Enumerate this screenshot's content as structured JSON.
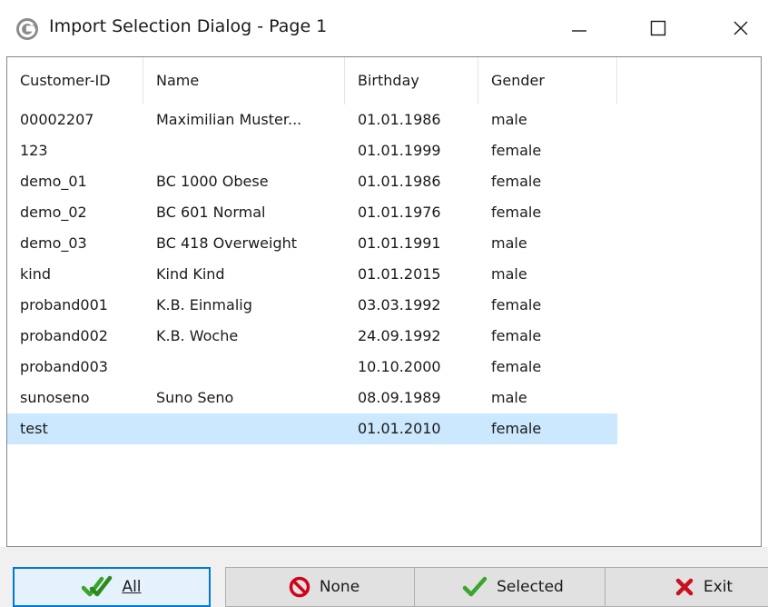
{
  "window": {
    "title": "Import Selection Dialog - Page 1",
    "app_icon_letter": "G"
  },
  "table": {
    "columns": [
      "Customer-ID",
      "Name",
      "Birthday",
      "Gender"
    ],
    "rows": [
      {
        "id": "00002207",
        "name": "Maximilian Muster...",
        "birthday": "01.01.1986",
        "gender": "male"
      },
      {
        "id": "123",
        "name": "",
        "birthday": "01.01.1999",
        "gender": "female"
      },
      {
        "id": "demo_01",
        "name": "BC 1000 Obese",
        "birthday": "01.01.1986",
        "gender": "female"
      },
      {
        "id": "demo_02",
        "name": "BC 601 Normal",
        "birthday": "01.01.1976",
        "gender": "female"
      },
      {
        "id": "demo_03",
        "name": "BC 418 Overweight",
        "birthday": "01.01.1991",
        "gender": "male"
      },
      {
        "id": "kind",
        "name": "Kind Kind",
        "birthday": "01.01.2015",
        "gender": "male"
      },
      {
        "id": "proband001",
        "name": "K.B. Einmalig",
        "birthday": "03.03.1992",
        "gender": "female"
      },
      {
        "id": "proband002",
        "name": "K.B. Woche",
        "birthday": "24.09.1992",
        "gender": "female"
      },
      {
        "id": "proband003",
        "name": "",
        "birthday": "10.10.2000",
        "gender": "female"
      },
      {
        "id": "sunoseno",
        "name": "Suno Seno",
        "birthday": "08.09.1989",
        "gender": "male"
      },
      {
        "id": "test",
        "name": "",
        "birthday": "01.01.2010",
        "gender": "female"
      }
    ],
    "selected_row": 10
  },
  "buttons": {
    "all": "All",
    "none": "None",
    "selected": "Selected",
    "exit": "Exit"
  },
  "icons": {
    "all": "double-checkmark-icon",
    "none": "prohibited-icon",
    "selected": "checkmark-icon",
    "exit": "red-x-icon"
  },
  "colors": {
    "selection": "#cce8ff",
    "check_green": "#3aa52a",
    "none_red": "#d0021b",
    "exit_red": "#c8101e",
    "default_button_border": "#0078d7"
  }
}
